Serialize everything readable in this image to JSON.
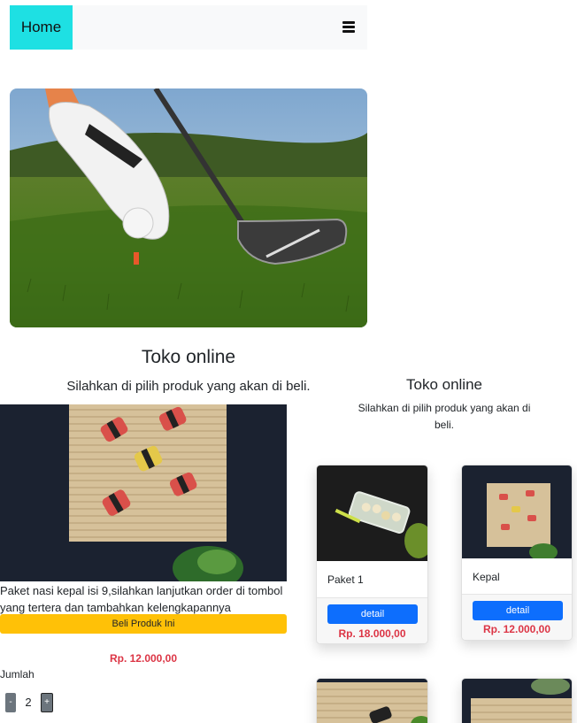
{
  "navbar": {
    "home_label": "Home",
    "menu_icon": "hamburger-menu-icon"
  },
  "hero": {
    "image": "golf-hero-image"
  },
  "left": {
    "title": "Toko online",
    "subtitle": "Silahkan di pilih produk yang akan di beli."
  },
  "detail": {
    "image": "sushi-mat-image",
    "description": "Paket nasi kepal isi 9,silahkan lanjutkan order di tombol yang tertera dan tambahkan kelengkapannya",
    "buy_label": "Beli Produk Ini",
    "price": "Rp. 12.000,00",
    "qty_label": "Jumlah",
    "qty_minus": "-",
    "qty_value": "2",
    "qty_plus": "+"
  },
  "right": {
    "title": "Toko online",
    "subtitle": "Silahkan di pilih produk yang akan di beli."
  },
  "products": [
    {
      "name": "Paket 1",
      "button": "detail",
      "price": "Rp. 18.000,00"
    },
    {
      "name": "Kepal",
      "button": "detail",
      "price": "Rp. 12.000,00"
    }
  ],
  "colors": {
    "home_bg": "#1ee0e3",
    "buy_button": "#ffc107",
    "detail_button": "#0d6efd",
    "price": "#dc3545"
  }
}
